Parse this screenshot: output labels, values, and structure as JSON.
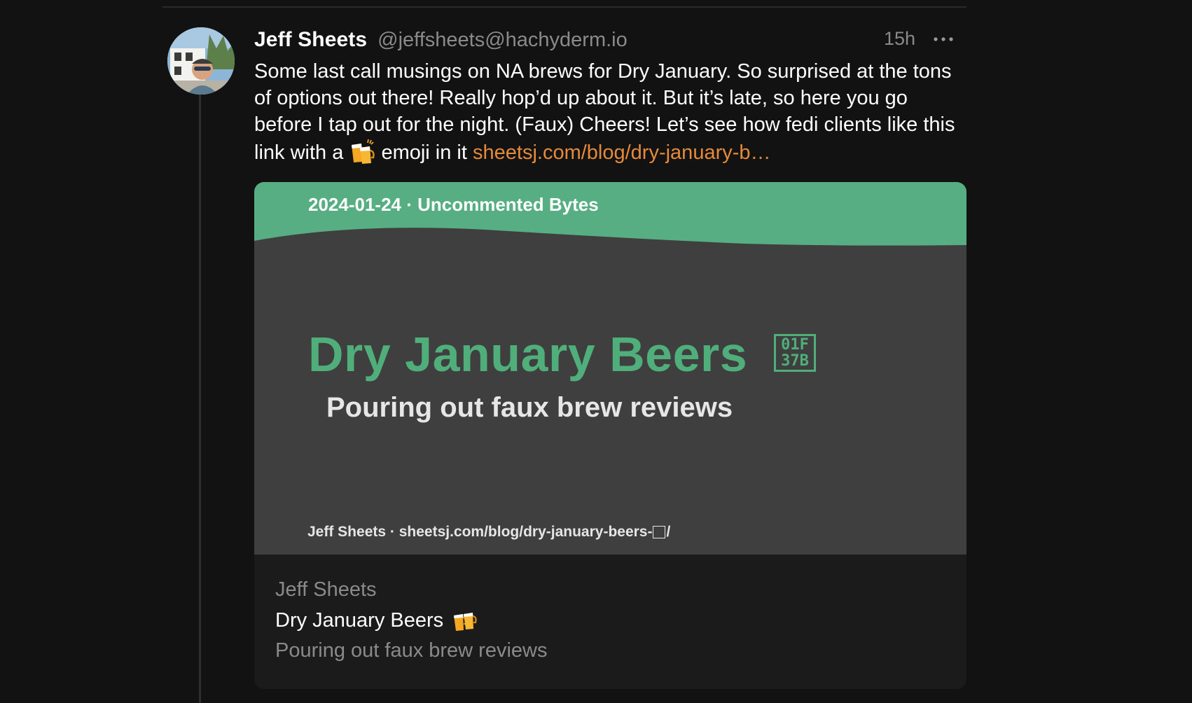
{
  "post": {
    "author_name": "Jeff Sheets",
    "author_handle": "@jeffsheets@hachyderm.io",
    "timestamp": "15h",
    "text_before_emoji": "Some last call musings on NA brews for Dry January. So surprised at the tons of options out there! Really hop’d up about it. But it’s late, so here you go before I tap out for the night. (Faux) Cheers! Let’s see how fedi clients like this link with a ",
    "text_after_emoji": " emoji in it ",
    "link_text": "sheetsj.com/blog/dry-january-b…",
    "inline_emoji": "clinking-beer-mugs-icon"
  },
  "card": {
    "image": {
      "meta": "2024-01-24 · Uncommented Bytes",
      "title": "Dry January Beers",
      "title_glyph_code": [
        "01F",
        "37B"
      ],
      "subtitle": "Pouring out faux brew reviews",
      "footer_prefix": "Jeff Sheets · sheetsj.com/blog/dry-january-beers-",
      "footer_suffix": "/"
    },
    "author": "Jeff Sheets",
    "title": "Dry January Beers",
    "description": "Pouring out faux brew reviews"
  },
  "colors": {
    "background": "#121212",
    "link": "#e48a3a",
    "accent_green": "#4fae7a",
    "muted": "#8a8a8a"
  }
}
